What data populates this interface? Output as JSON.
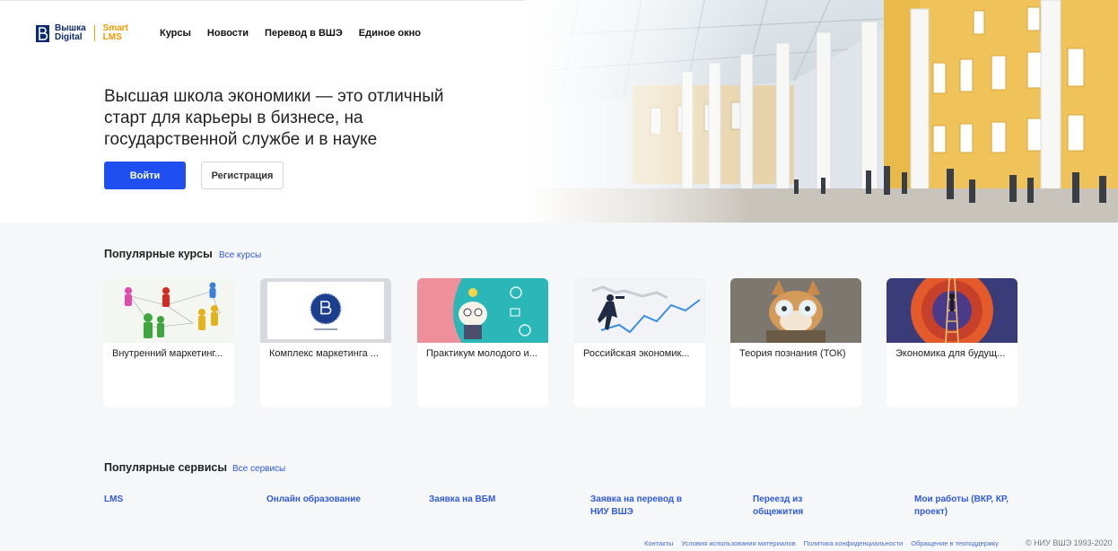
{
  "header": {
    "logo": {
      "primary_line1": "Вышка",
      "primary_line2": "Digital",
      "secondary_line1": "Smart",
      "secondary_line2": "LMS"
    },
    "nav": [
      "Курсы",
      "Новости",
      "Перевод в ВШЭ",
      "Единое окно"
    ]
  },
  "hero": {
    "title": "Высшая школа экономики — это отличный старт для карьеры в бизнесе, на государственной службе и в науке",
    "login_label": "Войти",
    "register_label": "Регистрация"
  },
  "popular_courses": {
    "title": "Популярные курсы",
    "link": "Все курсы",
    "items": [
      {
        "label": "Внутренний маркетинг...",
        "image": "people-network-image"
      },
      {
        "label": "Комплекс маркетинга ...",
        "image": "hse-logo-image"
      },
      {
        "label": "Практикум молодого и...",
        "image": "scientist-illustration-image"
      },
      {
        "label": "Российская экономик...",
        "image": "business-chart-image"
      },
      {
        "label": "Теория познания (ТОК)",
        "image": "cat-with-glasses-image"
      },
      {
        "label": "Экономика для будущ...",
        "image": "ladder-illustration-image"
      }
    ]
  },
  "popular_services": {
    "title": "Популярные сервисы",
    "link": "Все сервисы",
    "items": [
      {
        "line1": "LMS",
        "line2": ""
      },
      {
        "line1": "Онлайн образование",
        "line2": ""
      },
      {
        "line1": "Заявка на ВБМ",
        "line2": ""
      },
      {
        "line1": "Заявка на перевод в",
        "line2": "НИУ ВШЭ"
      },
      {
        "line1": "Переезд из",
        "line2": "общежития"
      },
      {
        "line1": "Мои работы (ВКР, КР,",
        "line2": "проект)"
      }
    ]
  },
  "footer": {
    "links": [
      "Контакты",
      "Условия использования материалов",
      "Политика конфиденциальности",
      "Обращение в техподдержку"
    ],
    "copyright": "© НИУ ВШЭ 1993-2020"
  },
  "colors": {
    "accent": "#1f4ff0",
    "link": "#2f59e6",
    "brand_orange": "#f39a00",
    "background": "#f6f7f8"
  }
}
